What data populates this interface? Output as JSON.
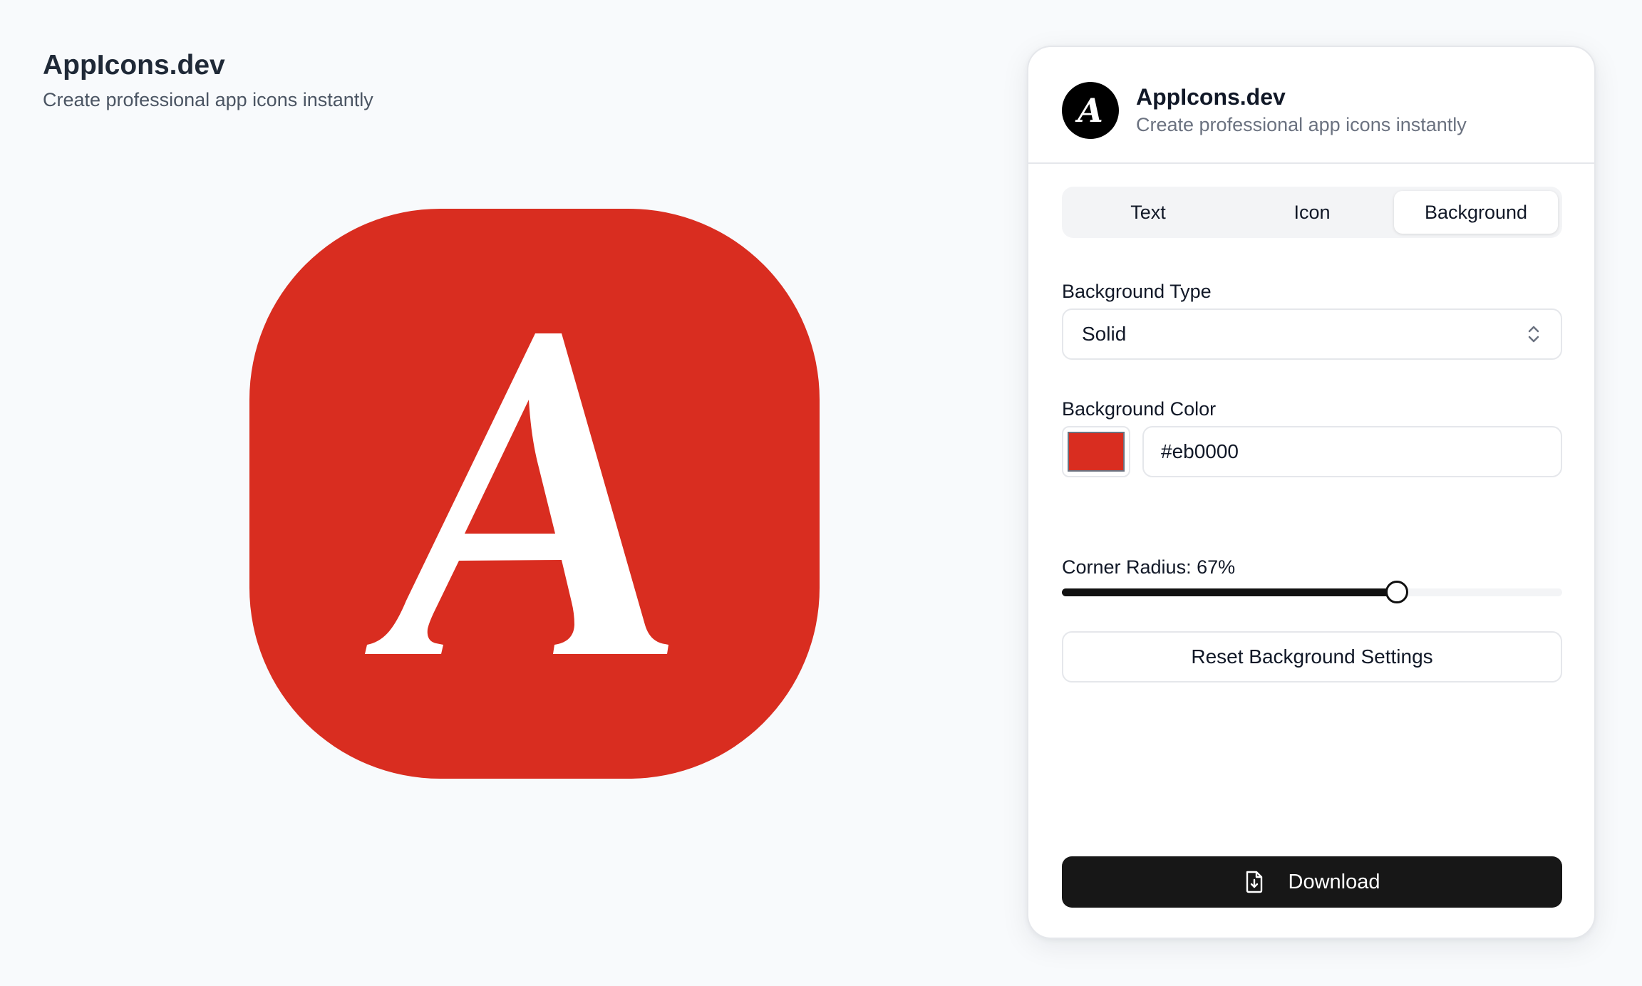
{
  "app": {
    "title": "AppIcons.dev",
    "subtitle": "Create professional app icons instantly"
  },
  "preview": {
    "glyph": "A",
    "background_color": "#d92d20",
    "glyph_color": "#ffffff",
    "corner_radius_percent": 67
  },
  "panel": {
    "avatar_glyph": "A",
    "title": "AppIcons.dev",
    "subtitle": "Create professional app icons instantly",
    "tabs": [
      {
        "label": "Text",
        "active": false
      },
      {
        "label": "Icon",
        "active": false
      },
      {
        "label": "Background",
        "active": true
      }
    ],
    "background_type": {
      "label": "Background Type",
      "value": "Solid"
    },
    "background_color": {
      "label": "Background Color",
      "swatch_color": "#d92d20",
      "value": "#eb0000"
    },
    "corner_radius": {
      "label": "Corner Radius: 67%",
      "value_percent": 67
    },
    "reset_label": "Reset Background Settings",
    "download_label": "Download"
  },
  "colors": {
    "accent_dark": "#171717",
    "page_background": "#f8fafc"
  }
}
